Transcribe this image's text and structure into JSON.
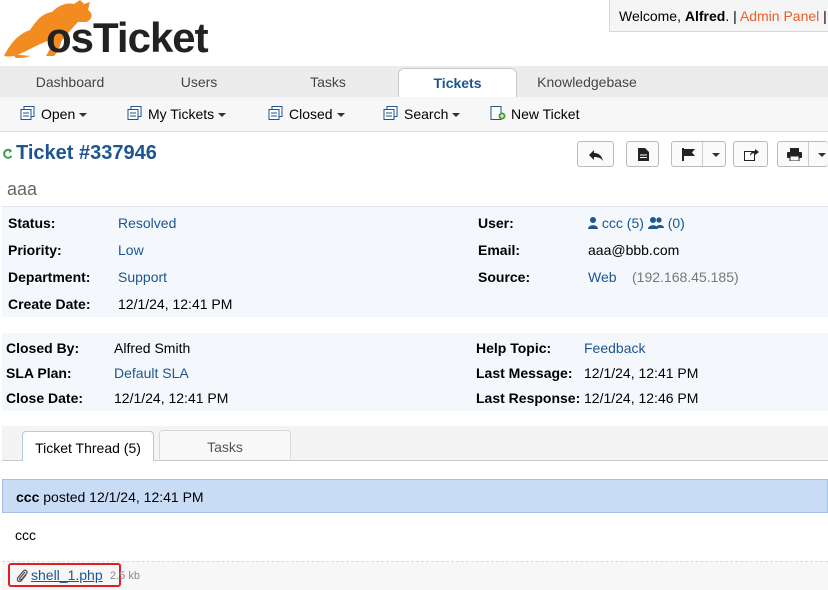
{
  "brand": {
    "logo_text": "osTicket"
  },
  "header": {
    "welcome_prefix": "Welcome, ",
    "user_name": "Alfred",
    "welcome_suffix": ". |",
    "admin_panel": "Admin Panel",
    "trailing_sep": "|"
  },
  "nav": {
    "tabs": [
      {
        "label": "Dashboard"
      },
      {
        "label": "Users"
      },
      {
        "label": "Tasks"
      },
      {
        "label": "Tickets",
        "active": true
      },
      {
        "label": "Knowledgebase"
      }
    ]
  },
  "subnav": {
    "items": [
      {
        "label": "Open",
        "icon": "tickets-icon",
        "dropdown": true
      },
      {
        "label": "My Tickets",
        "icon": "tickets-icon",
        "dropdown": true
      },
      {
        "label": "Closed",
        "icon": "tickets-icon",
        "dropdown": true
      },
      {
        "label": "Search",
        "icon": "tickets-icon",
        "dropdown": true
      },
      {
        "label": "New Ticket",
        "icon": "new-ticket-icon",
        "dropdown": false
      }
    ]
  },
  "ticket": {
    "title": "Ticket #337946",
    "subject": "aaa",
    "actions": [
      "reply-icon",
      "pdf-icon",
      "flag-icon",
      "transfer-icon",
      "print-icon"
    ]
  },
  "info1": {
    "status_label": "Status:",
    "status": "Resolved",
    "priority_label": "Priority:",
    "priority": "Low",
    "department_label": "Department:",
    "department": "Support",
    "create_date_label": "Create Date:",
    "create_date": "12/1/24, 12:41 PM",
    "user_label": "User:",
    "user": "ccc",
    "user_tickets": "(5)",
    "user_org_count": "(0)",
    "email_label": "Email:",
    "email": "aaa@bbb.com",
    "source_label": "Source:",
    "source": "Web",
    "source_ip": "(192.168.45.185)"
  },
  "info2": {
    "closed_by_label": "Closed By:",
    "closed_by": "Alfred Smith",
    "sla_label": "SLA Plan:",
    "sla": "Default SLA",
    "close_date_label": "Close Date:",
    "close_date": "12/1/24, 12:41 PM",
    "help_topic_label": "Help Topic:",
    "help_topic": "Feedback",
    "last_message_label": "Last Message:",
    "last_message": "12/1/24, 12:41 PM",
    "last_response_label": "Last Response:",
    "last_response": "12/1/24, 12:46 PM"
  },
  "thread_tabs": {
    "thread": "Ticket Thread (5)",
    "tasks": "Tasks"
  },
  "entry": {
    "author": "ccc",
    "posted": " posted 12/1/24, 12:41 PM",
    "body": "ccc",
    "attachment_name": "shell_1.php",
    "attachment_size": "2.5 kb"
  },
  "colors": {
    "accent": "#1c5591",
    "logo_orange": "#f28b20",
    "highlight": "#e02020",
    "entry_header": "#c9dcf6"
  }
}
